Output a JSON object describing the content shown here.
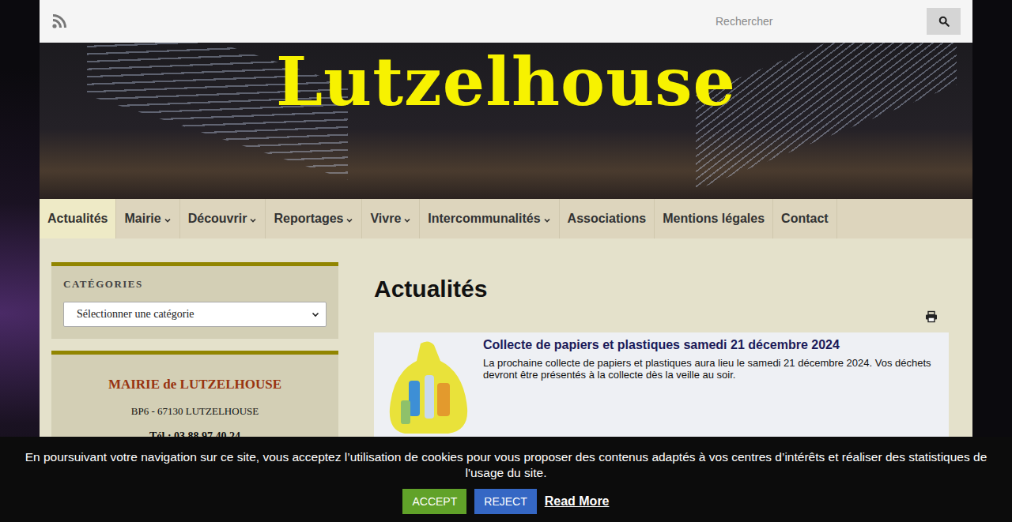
{
  "top_bar": {
    "search": {
      "placeholder": "Rechercher"
    }
  },
  "site_title": "Lutzelhouse",
  "nav": [
    {
      "label": "Actualités",
      "selected": true,
      "has_submenu": false
    },
    {
      "label": "Mairie",
      "selected": false,
      "has_submenu": true
    },
    {
      "label": "Découvrir",
      "selected": false,
      "has_submenu": true
    },
    {
      "label": "Reportages",
      "selected": false,
      "has_submenu": true
    },
    {
      "label": "Vivre",
      "selected": false,
      "has_submenu": true
    },
    {
      "label": "Intercommunalités",
      "selected": false,
      "has_submenu": true
    },
    {
      "label": "Associations",
      "selected": false,
      "has_submenu": false
    },
    {
      "label": "Mentions légales",
      "selected": false,
      "has_submenu": false
    },
    {
      "label": "Contact",
      "selected": false,
      "has_submenu": false
    }
  ],
  "sidebar": {
    "categories": {
      "title": "CATÉGORIES",
      "select": "Sélectionner une catégorie"
    },
    "mairie": {
      "name": "MAIRIE de LUTZELHOUSE",
      "address": "BP6 - 67130 LUTZELHOUSE",
      "phone": "Tél : 03 88 97 40 24"
    }
  },
  "page_title": "Actualités",
  "articles": [
    {
      "title": "Collecte de papiers et plastiques samedi 21 décembre 2024",
      "excerpt": "La prochaine collecte de papiers et plastiques aura lieu le samedi 21 décembre 2024. Vos déchets devront être présentés à la collecte dès la veille au soir."
    }
  ],
  "cookie_banner": {
    "text": "En poursuivant votre navigation sur ce site, vous acceptez l’utilisation de cookies pour vous proposer des contenus adaptés à vos centres d’intérêts et réaliser des statistiques de l'usage du site.",
    "accept": "ACCEPT",
    "reject": "REJECT",
    "read_more": "Read More"
  }
}
